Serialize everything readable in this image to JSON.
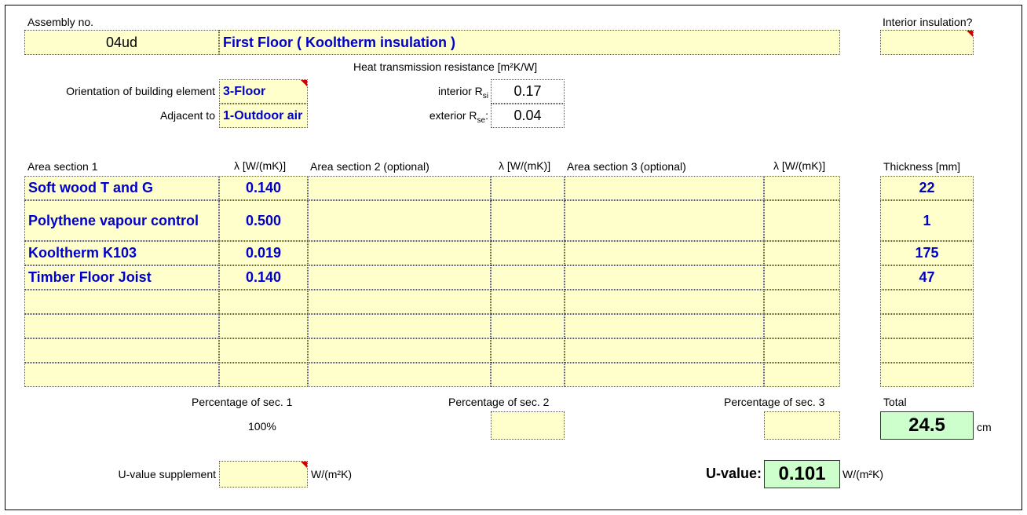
{
  "assembly": {
    "label": "Assembly no.",
    "number": "04ud",
    "name": "First Floor  ( Kooltherm insulation )",
    "interior_insulation_label": "Interior insulation?",
    "interior_insulation_value": ""
  },
  "resistance": {
    "heading": "Heat transmission resistance  [m²K/W]",
    "interior_label": "interior R",
    "interior_sub": "si",
    "interior_value": "0.17",
    "exterior_label": "exterior R",
    "exterior_sub": "se",
    "exterior_suffix": ":",
    "exterior_value": "0.04"
  },
  "element": {
    "orientation_label": "Orientation of building element",
    "orientation_value": "3-Floor",
    "adjacent_label": "Adjacent to",
    "adjacent_value": "1-Outdoor air"
  },
  "table": {
    "headers": {
      "area1": "Area section 1",
      "lambda1": "λ [W/(mK)]",
      "area2": "Area section 2 (optional)",
      "lambda2": "λ [W/(mK)]",
      "area3": "Area section 3 (optional)",
      "lambda3": "λ [W/(mK)]",
      "thickness": "Thickness [mm]"
    },
    "rows": [
      {
        "material": "Soft wood T and G",
        "lambda": "0.140",
        "thickness": "22"
      },
      {
        "material": "Polythene vapour control",
        "lambda": "0.500",
        "thickness": "1"
      },
      {
        "material": "Kooltherm K103",
        "lambda": "0.019",
        "thickness": "175"
      },
      {
        "material": "Timber Floor Joist",
        "lambda": "0.140",
        "thickness": "47"
      },
      {
        "material": "",
        "lambda": "",
        "thickness": ""
      },
      {
        "material": "",
        "lambda": "",
        "thickness": ""
      },
      {
        "material": "",
        "lambda": "",
        "thickness": ""
      },
      {
        "material": "",
        "lambda": "",
        "thickness": ""
      }
    ]
  },
  "percentages": {
    "sec1_label": "Percentage of sec. 1",
    "sec1_value": "100%",
    "sec2_label": "Percentage of sec. 2",
    "sec2_value": "",
    "sec3_label": "Percentage of sec. 3",
    "sec3_value": ""
  },
  "total": {
    "label": "Total",
    "value": "24.5",
    "unit": "cm"
  },
  "supplement": {
    "label": "U-value supplement",
    "value": "",
    "unit": "W/(m²K)"
  },
  "uvalue": {
    "label": "U-value:",
    "value": "0.101",
    "unit": "W/(m²K)"
  },
  "colors": {
    "input_fill": "#ffffcc",
    "result_fill": "#ccffcc",
    "input_text": "#0000cc",
    "comment_marker": "#cc0000"
  }
}
